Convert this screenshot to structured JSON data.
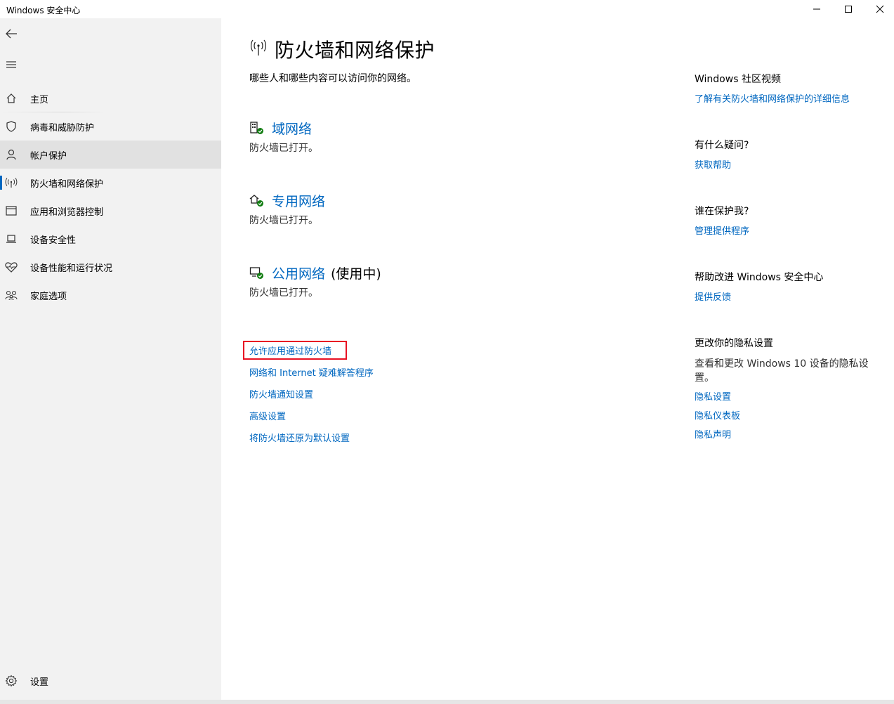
{
  "window": {
    "title": "Windows 安全中心"
  },
  "sidebar": {
    "items": [
      {
        "label": "主页"
      },
      {
        "label": "病毒和威胁防护"
      },
      {
        "label": "帐户保护"
      },
      {
        "label": "防火墙和网络保护"
      },
      {
        "label": "应用和浏览器控制"
      },
      {
        "label": "设备安全性"
      },
      {
        "label": "设备性能和运行状况"
      },
      {
        "label": "家庭选项"
      }
    ],
    "settings_label": "设置"
  },
  "main": {
    "title": "防火墙和网络保护",
    "description": "哪些人和哪些内容可以访问你的网络。",
    "networks": [
      {
        "name": "域网络",
        "suffix": "",
        "status": "防火墙已打开。"
      },
      {
        "name": "专用网络",
        "suffix": "",
        "status": "防火墙已打开。"
      },
      {
        "name": "公用网络",
        "suffix": "(使用中)",
        "status": "防火墙已打开。"
      }
    ],
    "links": [
      "允许应用通过防火墙",
      "网络和 Internet 疑难解答程序",
      "防火墙通知设置",
      "高级设置",
      "将防火墙还原为默认设置"
    ]
  },
  "right": {
    "video": {
      "heading": "Windows 社区视频",
      "link": "了解有关防火墙和网络保护的详细信息"
    },
    "question": {
      "heading": "有什么疑问?",
      "link": "获取帮助"
    },
    "protect": {
      "heading": "谁在保护我?",
      "link": "管理提供程序"
    },
    "improve": {
      "heading": "帮助改进 Windows 安全中心",
      "link": "提供反馈"
    },
    "privacy": {
      "heading": "更改你的隐私设置",
      "text": "查看和更改 Windows 10 设备的隐私设置。",
      "links": [
        "隐私设置",
        "隐私仪表板",
        "隐私声明"
      ]
    }
  },
  "colors": {
    "accent": "#0067c0",
    "highlight_border": "#e81123",
    "sidebar_bg": "#f2f2f2",
    "ok_green": "#107c10"
  }
}
